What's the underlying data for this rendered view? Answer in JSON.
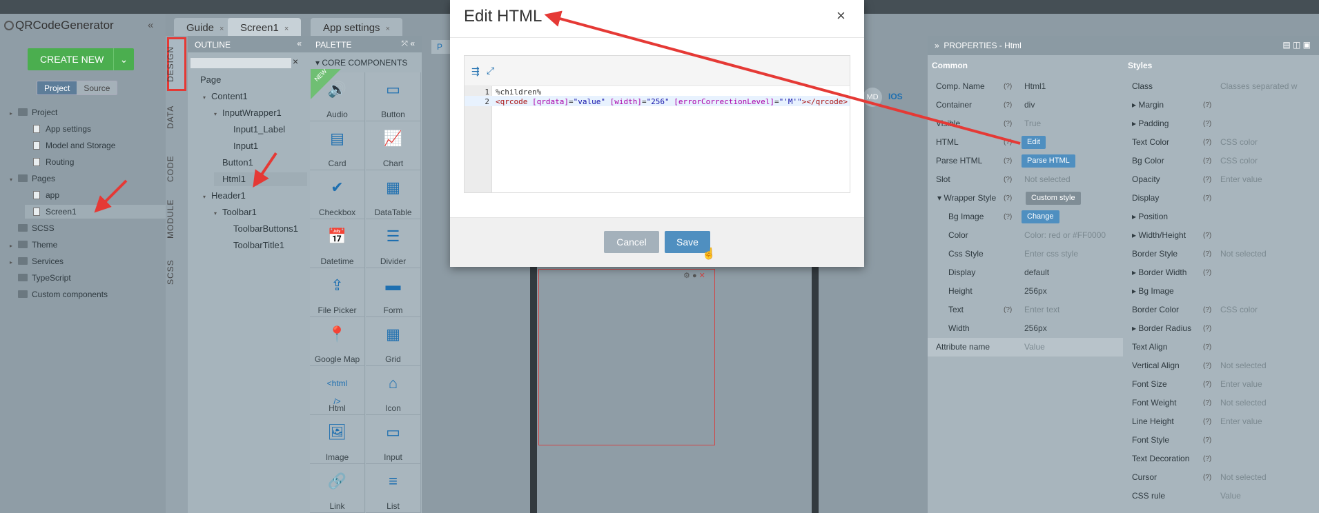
{
  "app": {
    "title": "QRCodeGenerator",
    "collapse": "«"
  },
  "left": {
    "create_new": "CREATE NEW",
    "create_chevron": "⌄",
    "seg": [
      "Project",
      "Source"
    ],
    "tree": [
      {
        "label": "Project",
        "level": 0,
        "caret": "▸",
        "type": "folder"
      },
      {
        "label": "App settings",
        "level": 1,
        "caret": "",
        "type": "file"
      },
      {
        "label": "Model and Storage",
        "level": 1,
        "caret": "",
        "type": "file"
      },
      {
        "label": "Routing",
        "level": 1,
        "caret": "",
        "type": "file"
      },
      {
        "label": "Pages",
        "level": 0,
        "caret": "▾",
        "type": "folder"
      },
      {
        "label": "app",
        "level": 1,
        "caret": "",
        "type": "file"
      },
      {
        "label": "Screen1",
        "level": 1,
        "caret": "",
        "type": "file"
      },
      {
        "label": "SCSS",
        "level": 0,
        "caret": "",
        "type": "folder"
      },
      {
        "label": "Theme",
        "level": 0,
        "caret": "▸",
        "type": "folder"
      },
      {
        "label": "Services",
        "level": 0,
        "caret": "▸",
        "type": "folder"
      },
      {
        "label": "TypeScript",
        "level": 0,
        "caret": "",
        "type": "folder"
      },
      {
        "label": "Custom components",
        "level": 0,
        "caret": "",
        "type": "folder"
      }
    ]
  },
  "vtabs": [
    "DESIGN",
    "DATA",
    "CODE",
    "MODULE",
    "SCSS"
  ],
  "tabs": [
    {
      "label": "Guide",
      "close": "×"
    },
    {
      "label": "Screen1",
      "close": "×"
    },
    {
      "label": "App settings",
      "close": "×"
    }
  ],
  "outline": {
    "title": "OUTLINE",
    "collapse": "«",
    "clear": "×",
    "items": [
      {
        "label": "Page",
        "level": 0,
        "caret": ""
      },
      {
        "label": "Content1",
        "level": 1,
        "caret": "▾"
      },
      {
        "label": "InputWrapper1",
        "level": 2,
        "caret": "▾"
      },
      {
        "label": "Input1_Label",
        "level": 3,
        "caret": ""
      },
      {
        "label": "Input1",
        "level": 3,
        "caret": ""
      },
      {
        "label": "Button1",
        "level": 2,
        "caret": ""
      },
      {
        "label": "Html1",
        "level": 2,
        "caret": ""
      },
      {
        "label": "Header1",
        "level": 1,
        "caret": "▾"
      },
      {
        "label": "Toolbar1",
        "level": 2,
        "caret": "▾"
      },
      {
        "label": "ToolbarButtons1",
        "level": 3,
        "caret": ""
      },
      {
        "label": "ToolbarTitle1",
        "level": 3,
        "caret": ""
      }
    ]
  },
  "palette": {
    "title": "PALETTE",
    "icons": "⤧ «",
    "sub": "▾ CORE COMPONENTS",
    "new_badge": "NEW",
    "items": [
      {
        "label": "Audio",
        "glyph": "🔊"
      },
      {
        "label": "Button",
        "glyph": "▭"
      },
      {
        "label": "Card",
        "glyph": "▤"
      },
      {
        "label": "Chart",
        "glyph": "📈"
      },
      {
        "label": "Checkbox",
        "glyph": "✔"
      },
      {
        "label": "DataTable",
        "glyph": "▦"
      },
      {
        "label": "Datetime",
        "glyph": "📅"
      },
      {
        "label": "Divider",
        "glyph": "☰"
      },
      {
        "label": "File Picker",
        "glyph": "⇪"
      },
      {
        "label": "Form",
        "glyph": "▬"
      },
      {
        "label": "Google Map",
        "glyph": "📍"
      },
      {
        "label": "Grid",
        "glyph": "▦"
      },
      {
        "label": "Html",
        "glyph": "<html />"
      },
      {
        "label": "Icon",
        "glyph": "⌂"
      },
      {
        "label": "Image",
        "glyph": "🖼"
      },
      {
        "label": "Input",
        "glyph": "▭"
      },
      {
        "label": "Link",
        "glyph": "🔗"
      },
      {
        "label": "List",
        "glyph": "≡"
      }
    ]
  },
  "canvas": {
    "md": "MD",
    "ios": "IOS",
    "tab_fragment": "P"
  },
  "props": {
    "title": "PROPERTIES - Html",
    "common": "Common",
    "styles": "Styles",
    "left_rows": [
      {
        "k": "Comp. Name",
        "q": "(?)",
        "v": "Html1",
        "hint": false,
        "btn": ""
      },
      {
        "k": "Container",
        "q": "(?)",
        "v": "div",
        "hint": false,
        "btn": ""
      },
      {
        "k": "Visible",
        "q": "(?)",
        "v": "True",
        "hint": true,
        "btn": ""
      },
      {
        "k": "HTML",
        "q": "(?)",
        "v": "",
        "hint": false,
        "btn": "Edit"
      },
      {
        "k": "Parse HTML",
        "q": "(?)",
        "v": "",
        "hint": false,
        "btn": "Parse HTML"
      },
      {
        "k": "Slot",
        "q": "(?)",
        "v": "Not selected",
        "hint": true,
        "btn": ""
      },
      {
        "k": "▾ Wrapper Style",
        "q": "(?)",
        "v": "",
        "hint": false,
        "btn": "Custom style"
      },
      {
        "k": "Bg Image",
        "q": "(?)",
        "v": "",
        "hint": false,
        "btn": "Change"
      },
      {
        "k": "Color",
        "q": "",
        "v": "Color: red or #FF0000",
        "hint": true,
        "btn": ""
      },
      {
        "k": "Css Style",
        "q": "",
        "v": "Enter css style",
        "hint": true,
        "btn": ""
      },
      {
        "k": "Display",
        "q": "",
        "v": "default",
        "hint": false,
        "btn": ""
      },
      {
        "k": "Height",
        "q": "",
        "v": "256px",
        "hint": false,
        "btn": ""
      },
      {
        "k": "Text",
        "q": "(?)",
        "v": "Enter text",
        "hint": true,
        "btn": ""
      },
      {
        "k": "Width",
        "q": "",
        "v": "256px",
        "hint": false,
        "btn": ""
      },
      {
        "k": "Attribute name",
        "q": "",
        "v": "Value",
        "hint": true,
        "btn": ""
      }
    ],
    "right_rows": [
      {
        "k": "Class",
        "q": "",
        "v": "Classes separated w"
      },
      {
        "k": "▸ Margin",
        "q": "(?)",
        "v": ""
      },
      {
        "k": "▸ Padding",
        "q": "(?)",
        "v": ""
      },
      {
        "k": "Text Color",
        "q": "(?)",
        "v": "CSS color"
      },
      {
        "k": "Bg Color",
        "q": "(?)",
        "v": "CSS color"
      },
      {
        "k": "Opacity",
        "q": "(?)",
        "v": "Enter value"
      },
      {
        "k": "Display",
        "q": "(?)",
        "v": ""
      },
      {
        "k": "▸ Position",
        "q": "",
        "v": ""
      },
      {
        "k": "▸ Width/Height",
        "q": "(?)",
        "v": ""
      },
      {
        "k": "Border Style",
        "q": "(?)",
        "v": "Not selected"
      },
      {
        "k": "▸ Border Width",
        "q": "(?)",
        "v": ""
      },
      {
        "k": "▸ Bg Image",
        "q": "",
        "v": ""
      },
      {
        "k": "Border Color",
        "q": "(?)",
        "v": "CSS color"
      },
      {
        "k": "▸ Border Radius",
        "q": "(?)",
        "v": ""
      },
      {
        "k": "Text Align",
        "q": "(?)",
        "v": ""
      },
      {
        "k": "Vertical Align",
        "q": "(?)",
        "v": "Not selected"
      },
      {
        "k": "Font Size",
        "q": "(?)",
        "v": "Enter value"
      },
      {
        "k": "Font Weight",
        "q": "(?)",
        "v": "Not selected"
      },
      {
        "k": "Line Height",
        "q": "(?)",
        "v": "Enter value"
      },
      {
        "k": "Font Style",
        "q": "(?)",
        "v": ""
      },
      {
        "k": "Text Decoration",
        "q": "(?)",
        "v": ""
      },
      {
        "k": "Cursor",
        "q": "(?)",
        "v": "Not selected"
      },
      {
        "k": "CSS rule",
        "q": "",
        "v": "Value"
      }
    ]
  },
  "modal": {
    "title": "Edit HTML",
    "close": "×",
    "line1_no": "1",
    "line2_no": "2",
    "line1": "%children%",
    "line2": {
      "open": "<qrcode",
      "a1": " [qrdata]",
      "e1": "=",
      "v1": "\"value\"",
      "a2": " [width]",
      "e2": "=",
      "v2": "\"256\"",
      "a3": " [errorCorrectionLevel]",
      "e3": "=",
      "v3": "\"'M'\"",
      "close": "></qrcode>"
    },
    "cancel": "Cancel",
    "save": "Save"
  },
  "colors": {
    "accent": "#4f8fc0",
    "create": "#4bae4f",
    "annot": "#e53935"
  }
}
